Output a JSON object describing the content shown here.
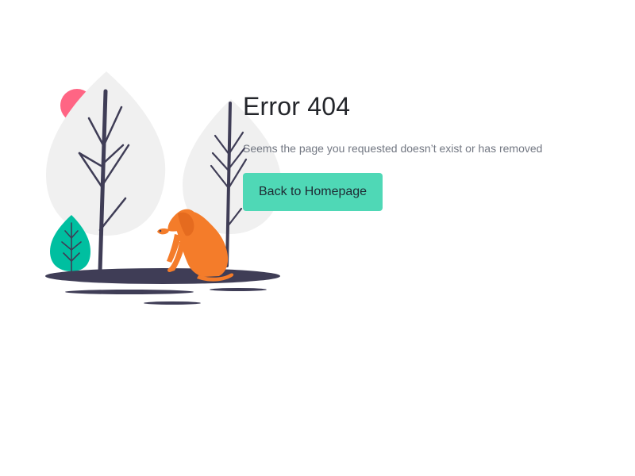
{
  "error": {
    "title": "Error 404",
    "message": "Seems the page you requested doesn’t exist or has removed",
    "button_label": "Back to Homepage"
  },
  "colors": {
    "accent": "#4fd8b6",
    "title_text": "#24262b",
    "message_text": "#727782",
    "leaf_light": "#f0f0f0",
    "leaf_teal": "#00bfa0",
    "sun_pink": "#ff6584",
    "trunk_dark": "#3f3d56",
    "dog_orange": "#f47c2a"
  }
}
